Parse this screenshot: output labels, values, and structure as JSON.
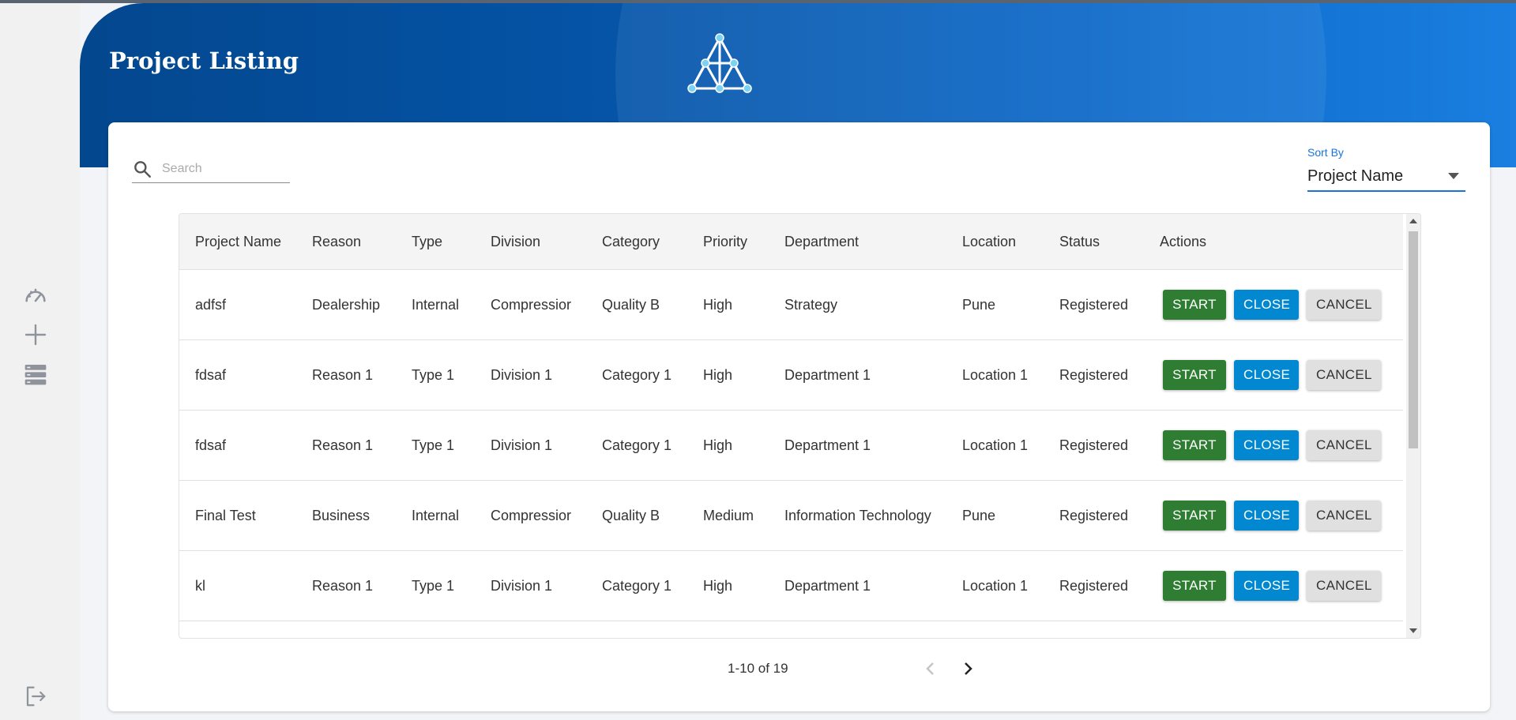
{
  "header": {
    "title": "Project Listing"
  },
  "sidebar": {
    "items": [
      {
        "icon": "dashboard-icon"
      },
      {
        "icon": "add-icon"
      },
      {
        "icon": "list-icon"
      },
      {
        "icon": "logout-icon"
      }
    ]
  },
  "search": {
    "placeholder": "Search"
  },
  "sort": {
    "label": "Sort By",
    "value": "Project Name"
  },
  "table": {
    "columns": [
      "Project Name",
      "Reason",
      "Type",
      "Division",
      "Category",
      "Priority",
      "Department",
      "Location",
      "Status",
      "Actions"
    ],
    "rows": [
      [
        "adfsf",
        "Dealership",
        "Internal",
        "Compressior",
        "Quality B",
        "High",
        "Strategy",
        "Pune",
        "Registered"
      ],
      [
        "fdsaf",
        "Reason 1",
        "Type 1",
        "Division 1",
        "Category 1",
        "High",
        "Department 1",
        "Location 1",
        "Registered"
      ],
      [
        "fdsaf",
        "Reason 1",
        "Type 1",
        "Division 1",
        "Category 1",
        "High",
        "Department 1",
        "Location 1",
        "Registered"
      ],
      [
        "Final Test",
        "Business",
        "Internal",
        "Compressior",
        "Quality B",
        "Medium",
        "Information Technology",
        "Pune",
        "Registered"
      ],
      [
        "kl",
        "Reason 1",
        "Type 1",
        "Division 1",
        "Category 1",
        "High",
        "Department 1",
        "Location 1",
        "Registered"
      ]
    ],
    "actions": {
      "start": "START",
      "close": "CLOSE",
      "cancel": "CANCEL"
    }
  },
  "pagination": {
    "info": "1-10 of 19"
  },
  "colors": {
    "banner": "#0553a6",
    "start": "#2e7d32",
    "close": "#0288d1",
    "cancel": "#e0e0e0",
    "accent": "#1a73d8"
  }
}
